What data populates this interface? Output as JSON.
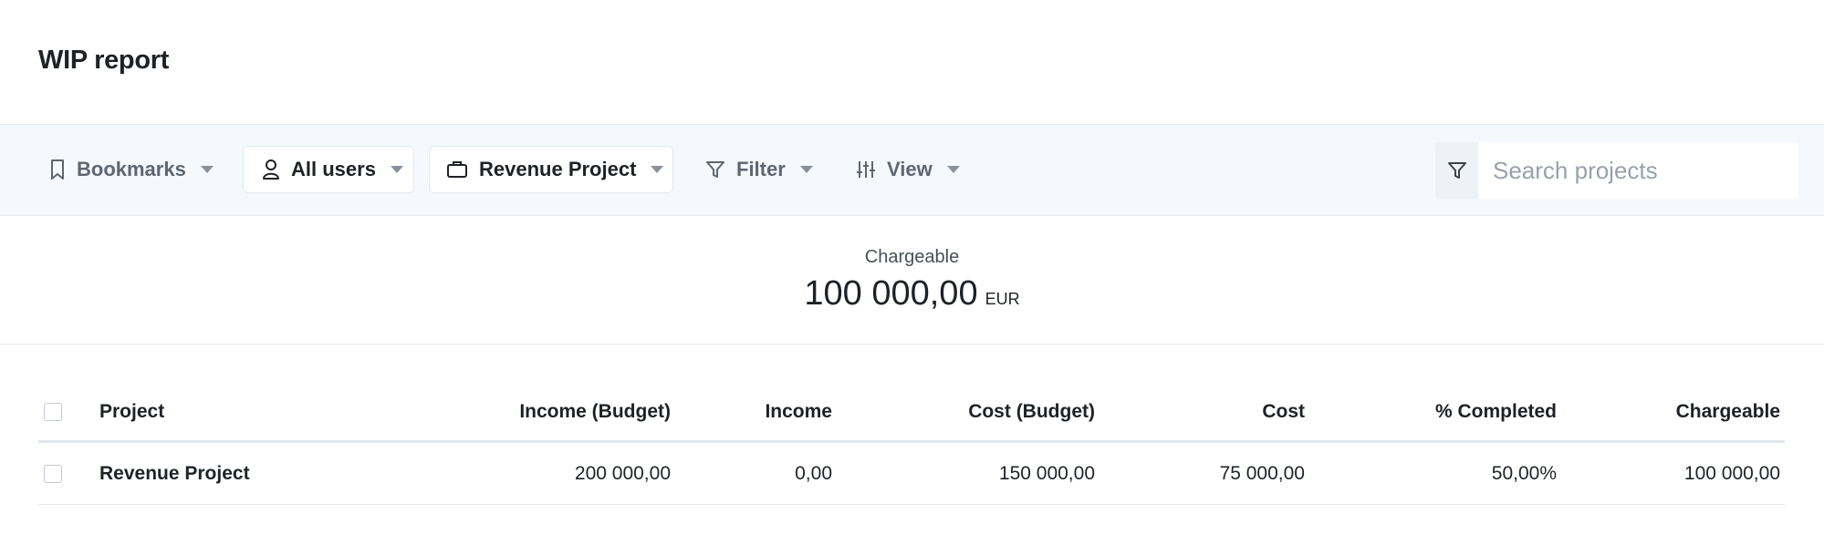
{
  "page": {
    "title": "WIP report"
  },
  "toolbar": {
    "bookmarks_label": "Bookmarks",
    "users_label": "All users",
    "project_label": "Revenue Project",
    "filter_label": "Filter",
    "view_label": "View",
    "search_placeholder": "Search projects"
  },
  "summary": {
    "label": "Chargeable",
    "value": "100 000,00",
    "currency": "EUR"
  },
  "table": {
    "headers": {
      "project": "Project",
      "income_budget": "Income (Budget)",
      "income": "Income",
      "cost_budget": "Cost (Budget)",
      "cost": "Cost",
      "completed": "% Completed",
      "chargeable": "Chargeable"
    },
    "rows": [
      {
        "project": "Revenue Project",
        "income_budget": "200 000,00",
        "income": "0,00",
        "cost_budget": "150 000,00",
        "cost": "75 000,00",
        "completed": "50,00%",
        "chargeable": "100 000,00"
      }
    ]
  },
  "colors": {
    "toolbar_bg": "#f5f8fc",
    "text_primary": "#1e2126",
    "text_muted": "#5e6672"
  }
}
